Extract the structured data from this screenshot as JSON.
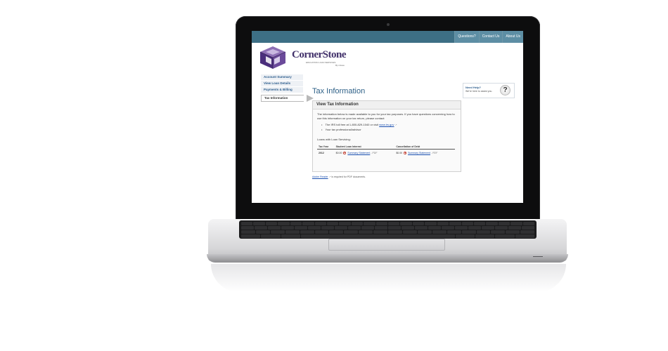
{
  "site": {
    "top_links": [
      "Questions?",
      "Contact Us",
      "About Us"
    ],
    "logo_text": "CornerStone",
    "logo_sub": "EDUCATION LOAN SERVICES",
    "logo_by": "By uheaa"
  },
  "sidebar": {
    "items": [
      {
        "label": "Account Summary",
        "active": false
      },
      {
        "label": "View Loan Details",
        "active": false
      },
      {
        "label": "Payments & Billing",
        "active": false
      },
      {
        "label": "Tax Information",
        "active": true
      }
    ]
  },
  "main": {
    "page_title": "Tax Information",
    "panel_title": "View Tax Information",
    "intro": "The information below is made available to you for your tax purposes. If you have questions concerning how to use this information on your tax return, please contact:",
    "bullet_1_text": "The IRS toll free at 1-800-829-1040 or visit",
    "bullet_1_link": "www.irs.gov",
    "bullet_2_text": "Your tax professional/advisor",
    "loans_heading": "Loans with Loan Servicing:",
    "table": {
      "headers": [
        "Tax Year",
        "Student Loan Interest",
        "Cancellation of Debt"
      ],
      "row": {
        "year": "2012",
        "interest_amount": "$0.00",
        "interest_link": "Summary Statement",
        "interest_pdf": "- PDF",
        "debt_amount": "$0.00",
        "debt_link": "Summary Statement",
        "debt_pdf": "- PDF"
      }
    },
    "footer_link": "Adobe Reader",
    "footer_text": "is required for PDF documents."
  },
  "help": {
    "title": "Need Help?",
    "text": "We're here to assist you.",
    "icon": "?"
  }
}
